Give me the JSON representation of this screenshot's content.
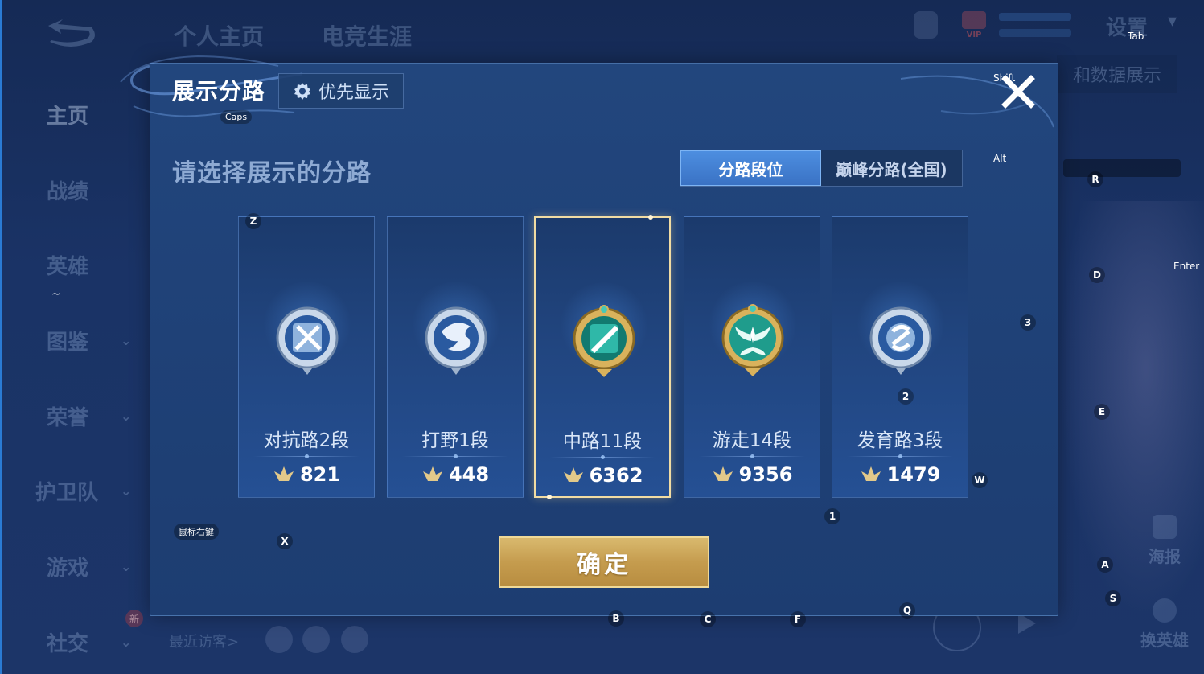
{
  "background": {
    "top_nav": [
      "个人主页",
      "电竞生涯"
    ],
    "settings": "设置",
    "vip_label": "VIP",
    "right_tab": "和数据展示",
    "sidebar": [
      {
        "label": "主页",
        "chevron": false
      },
      {
        "label": "战绩",
        "chevron": false
      },
      {
        "label": "英雄",
        "chevron": false
      },
      {
        "label": "图鉴",
        "chevron": true
      },
      {
        "label": "荣誉",
        "chevron": true
      },
      {
        "label": "护卫队",
        "chevron": true
      },
      {
        "label": "游戏",
        "chevron": true
      },
      {
        "label": "社交",
        "chevron": true
      }
    ],
    "new_badge": "新",
    "recent_visitors": "最近访客>",
    "poster": "海报",
    "swap_hero": "换英雄"
  },
  "modal": {
    "title": "展示分路",
    "priority_button": "优先显示",
    "prompt": "请选择展示的分路",
    "tabs": [
      {
        "label": "分路段位",
        "active": true
      },
      {
        "label": "巅峰分路(全国)",
        "active": false
      }
    ],
    "cards": [
      {
        "name": "对抗路2段",
        "score": "821",
        "emblem": "sword-emblem-icon",
        "color": "#8fb3dd",
        "selected": false
      },
      {
        "name": "打野1段",
        "score": "448",
        "emblem": "dragon-emblem-icon",
        "color": "#8fb3dd",
        "selected": false
      },
      {
        "name": "中路11段",
        "score": "6362",
        "emblem": "staff-emblem-icon",
        "color": "#2fb8a8",
        "selected": true
      },
      {
        "name": "游走14段",
        "score": "9356",
        "emblem": "wings-emblem-icon",
        "color": "#1f9c8c",
        "selected": false
      },
      {
        "name": "发育路3段",
        "score": "1479",
        "emblem": "bow-emblem-icon",
        "color": "#8fb3dd",
        "selected": false
      }
    ],
    "confirm_button": "确定"
  },
  "key_hints": {
    "tab": "Tab",
    "shift": "Shift",
    "caps": "Caps",
    "alt": "Alt",
    "enter": "Enter",
    "r": "R",
    "d": "D",
    "e": "E",
    "w": "W",
    "a": "A",
    "s": "S",
    "z": "Z",
    "x": "X",
    "b": "B",
    "c": "C",
    "f": "F",
    "q": "Q",
    "n1": "1",
    "n2": "2",
    "n3": "3",
    "tilde": "~",
    "right_click": "鼠标右键"
  },
  "colors": {
    "accent_blue": "#3a72c4",
    "confirm_gold": "#c59c4e",
    "selected_border": "#f1dca3"
  }
}
